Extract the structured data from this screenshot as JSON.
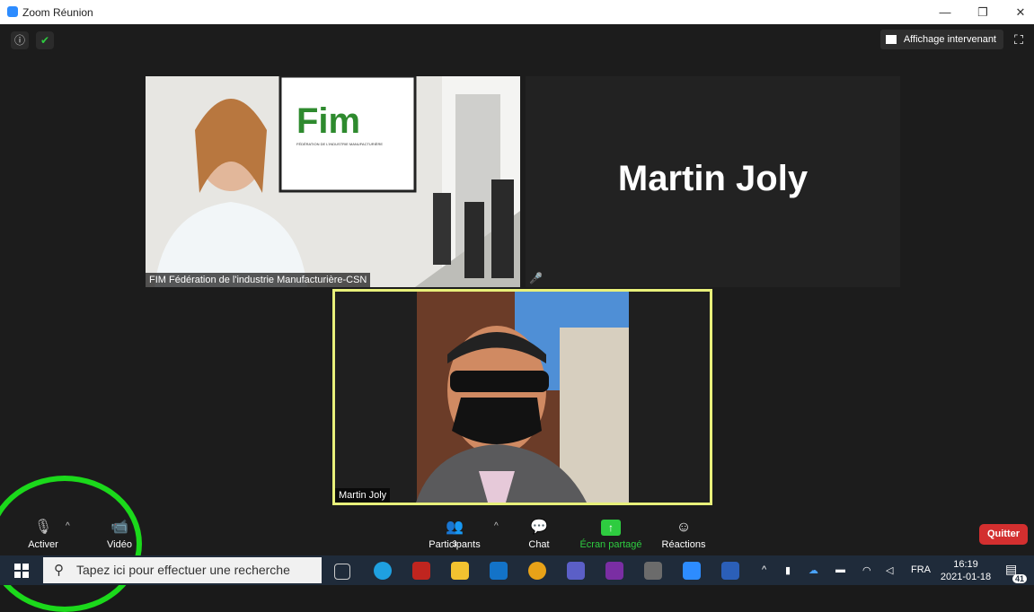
{
  "window": {
    "title": "Zoom Réunion",
    "minimize": "—",
    "restore": "❐",
    "close": "✕"
  },
  "top": {
    "info_glyph": "ⓘ",
    "shield_glyph": "✔",
    "speaker_view": "Affichage intervenant",
    "fullscreen_glyph": "⛶"
  },
  "tiles": {
    "fim_name": "FIM Fédération de l'industrie Manufacturière-CSN",
    "fim_logo": "Fim",
    "fim_logo_sub": "FÉDÉRATION DE L'INDUSTRIE MANUFACTURIÈRE",
    "martin_big": "Martin Joly",
    "self_name": "Martin Joly"
  },
  "toolbar": {
    "mute_label": "Activer",
    "video_label": "Vidéo",
    "participants_label": "Participants",
    "participants_count": "3",
    "chat_label": "Chat",
    "share_label": "Écran partagé",
    "reactions_label": "Réactions",
    "quit_label": "Quitter",
    "caret": "^"
  },
  "taskbar": {
    "search_placeholder": "Tapez ici pour effectuer une recherche",
    "lang": "FRA",
    "time": "16:19",
    "date": "2021-01-18",
    "notifications": "41"
  },
  "colors": {
    "accent_green": "#2ecc40",
    "quit_red": "#d32f2f",
    "active_speaker": "#e8f07a",
    "annotation_circle": "#1bd91b"
  }
}
